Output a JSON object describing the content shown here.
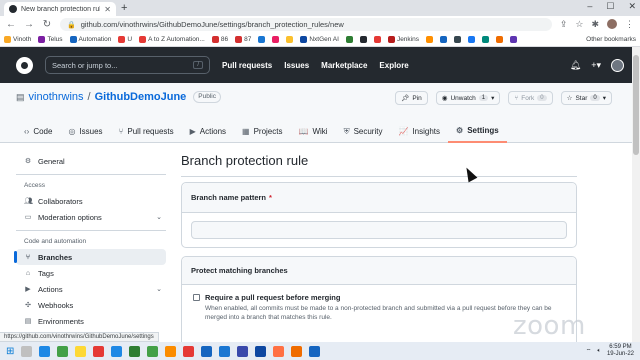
{
  "browser": {
    "tab_title": "New branch protection rule",
    "url": "github.com/vinothrwins/GithubDemoJune/settings/branch_protection_rules/new",
    "new_tab": "+",
    "win_min": "–",
    "win_max": "☐",
    "win_close": "✕",
    "back": "←",
    "forward": "→",
    "reload": "↻",
    "bookmarks": [
      {
        "label": "Vinoth",
        "color": "#f9a825"
      },
      {
        "label": "Telus",
        "color": "#7b1fa2"
      },
      {
        "label": "Automation",
        "color": "#1565c0"
      },
      {
        "label": "U",
        "color": "#e53935"
      },
      {
        "label": "A to Z Automation...",
        "color": "#e53935"
      },
      {
        "label": "86",
        "color": "#d32f2f"
      },
      {
        "label": "87",
        "color": "#d32f2f"
      },
      {
        "label": "",
        "color": "#1976d2"
      },
      {
        "label": "",
        "color": "#e91e63"
      },
      {
        "label": "",
        "color": "#fbc02d"
      },
      {
        "label": "NxtGen AI",
        "color": "#0d47a1"
      },
      {
        "label": "",
        "color": "#2e7d32"
      },
      {
        "label": "",
        "color": "#24292f"
      },
      {
        "label": "",
        "color": "#e53935"
      },
      {
        "label": "Jenkins",
        "color": "#b71c1c"
      },
      {
        "label": "",
        "color": "#ff8f00"
      },
      {
        "label": "",
        "color": "#1565c0"
      },
      {
        "label": "",
        "color": "#37474f"
      },
      {
        "label": "",
        "color": "#1877f2"
      },
      {
        "label": "",
        "color": "#00897b"
      },
      {
        "label": "",
        "color": "#ef6c00"
      },
      {
        "label": "",
        "color": "#5e35b1"
      }
    ],
    "other_bookmarks": "Other bookmarks",
    "status_url": "https://github.com/vinothrwins/GithubDemoJune/settings"
  },
  "github": {
    "search_placeholder": "Search or jump to...",
    "search_key": "/",
    "nav": [
      "Pull requests",
      "Issues",
      "Marketplace",
      "Explore"
    ],
    "plus": "+▾",
    "bell": "🔔"
  },
  "repo": {
    "owner": "vinothrwins",
    "separator": "/",
    "name": "GithubDemoJune",
    "visibility": "Public",
    "pin": "Pin",
    "unwatch": "Unwatch",
    "unwatch_count": "1",
    "fork": "Fork",
    "fork_count": "0",
    "star": "Star",
    "star_count": "0",
    "tabs": [
      {
        "label": "Code",
        "icon": "‹›"
      },
      {
        "label": "Issues",
        "icon": "◎"
      },
      {
        "label": "Pull requests",
        "icon": "⑂"
      },
      {
        "label": "Actions",
        "icon": "▶"
      },
      {
        "label": "Projects",
        "icon": "▦"
      },
      {
        "label": "Wiki",
        "icon": "📖"
      },
      {
        "label": "Security",
        "icon": "⛨"
      },
      {
        "label": "Insights",
        "icon": "📈"
      },
      {
        "label": "Settings",
        "icon": "⚙"
      }
    ]
  },
  "sidebar": {
    "general": "General",
    "access_heading": "Access",
    "collaborators": "Collaborators",
    "moderation": "Moderation options",
    "code_heading": "Code and automation",
    "branches": "Branches",
    "tags": "Tags",
    "actions": "Actions",
    "webhooks": "Webhooks",
    "environments": "Environments"
  },
  "main": {
    "title": "Branch protection rule",
    "pattern_label": "Branch name pattern",
    "required_mark": "*",
    "protect_heading": "Protect matching branches",
    "require_pr_label": "Require a pull request before merging",
    "require_pr_desc": "When enabled, all commits must be made to a non-protected branch and submitted via a pull request before they can be merged into a branch that matches this rule."
  },
  "taskbar": {
    "time": "6:59 PM",
    "date": "19-Jun-22",
    "apps": [
      "#c0c0c0",
      "#1e88e5",
      "#43a047",
      "#fdd835",
      "#e53935",
      "#1e88e5",
      "#2e7d32",
      "#43a047",
      "#fb8c00",
      "#e53935",
      "#1565c0",
      "#1976d2",
      "#3949ab",
      "#0d47a1",
      "#ff7043",
      "#ef6c00",
      "#1565c0"
    ]
  },
  "watermark": "zoom"
}
